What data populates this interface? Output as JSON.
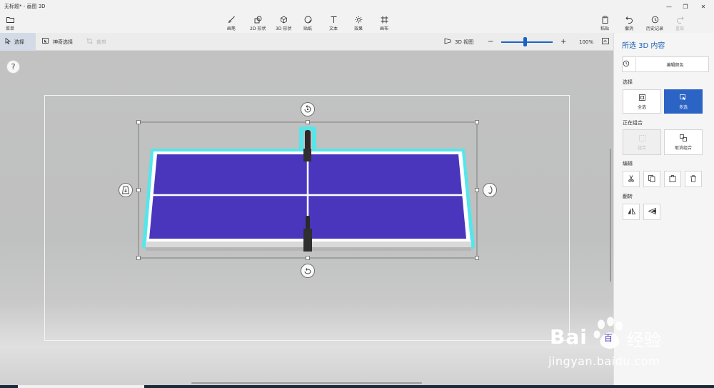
{
  "window": {
    "title": "无标题* - 画图 3D",
    "controls": [
      "—",
      "❐",
      "✕"
    ]
  },
  "ribbon": {
    "menu_label": "菜单",
    "tools": [
      {
        "label": "画笔"
      },
      {
        "label": "2D 形状"
      },
      {
        "label": "3D 形状"
      },
      {
        "label": "贴纸"
      },
      {
        "label": "文本"
      },
      {
        "label": "效果"
      },
      {
        "label": "画布"
      }
    ],
    "right": [
      {
        "label": "粘贴"
      },
      {
        "label": "撤消"
      },
      {
        "label": "历史记录"
      },
      {
        "label": "重做"
      }
    ]
  },
  "toolbar": {
    "select_label": "选择",
    "magic_select_label": "神奇选择",
    "crop_label": "裁剪",
    "view3d_label": "3D 视图",
    "zoom_minus": "−",
    "zoom_plus": "+",
    "zoom_value": "100%",
    "zoom_fraction": 0.47
  },
  "canvas": {
    "help_label": "?",
    "object": "ping-pong table",
    "colors": {
      "table_top": "#4a36bd",
      "table_edge": "#ffffff",
      "selection_glow": "#4fe3e7",
      "net_post": "#2a2a2a"
    }
  },
  "panel": {
    "title": "所选 3D 内容",
    "edit_color_label": "编辑颜色",
    "select_section": "选择",
    "select_all_label": "全选",
    "multi_select_label": "多选",
    "grouping_section": "正在组合",
    "group_label": "组合",
    "ungroup_label": "取消组合",
    "edit_section": "编辑",
    "flip_section": "翻转"
  },
  "watermark": {
    "brand": "Bai",
    "brand_tail": "百",
    "site_cn": "经验",
    "url": "jingyan.baidu.com"
  },
  "accent": "#2b64c4"
}
